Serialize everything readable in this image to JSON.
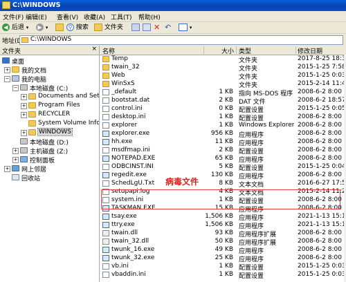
{
  "window": {
    "title": "C:\\WINDOWS"
  },
  "menu": [
    "文件(F)",
    "编辑(E)",
    "查看(V)",
    "收藏(A)",
    "工具(T)",
    "帮助(H)"
  ],
  "toolbar": {
    "back": "后退",
    "search": "搜索",
    "folders": "文件夹"
  },
  "address": {
    "label": "地址(D)",
    "value": "C:\\WINDOWS"
  },
  "left_pane": {
    "title": "文件夹",
    "close": "×",
    "tree": [
      {
        "label": "桌面",
        "icon": "desktop-icon"
      },
      {
        "label": "我的文档",
        "icon": "my-documents-icon",
        "pm": "+"
      },
      {
        "label": "我的电脑",
        "icon": "my-computer-icon",
        "pm": "−"
      },
      {
        "label": "本地磁盘 (C:)",
        "icon": "local-disk-icon",
        "pm": "−"
      },
      {
        "label": "Documents and Settings",
        "icon": "folder-icon",
        "pm": "+"
      },
      {
        "label": "Program Files",
        "icon": "folder-icon",
        "pm": "+"
      },
      {
        "label": "RECYCLER",
        "icon": "folder-icon",
        "pm": "+"
      },
      {
        "label": "System Volume Informat",
        "icon": "folder-icon",
        "pm": ""
      },
      {
        "label": "WINDOWS",
        "icon": "folder-icon",
        "pm": "+"
      },
      {
        "label": "本地磁盘 (D:)",
        "icon": "local-disk-icon",
        "pm": ""
      },
      {
        "label": "主机磁盘 (Z:)",
        "icon": "host-disk-icon",
        "pm": "+"
      },
      {
        "label": "控制面板",
        "icon": "control-panel-icon",
        "pm": "+"
      },
      {
        "label": "网上邻居",
        "icon": "network-icon",
        "pm": "+"
      },
      {
        "label": "回收站",
        "icon": "recycle-bin-icon",
        "pm": ""
      }
    ]
  },
  "columns": {
    "name": "名称",
    "size": "大小",
    "type": "类型",
    "modified": "修改日期"
  },
  "files": [
    {
      "name": "Temp",
      "size": "",
      "type": "文件夹",
      "date": "2017-8-25 18:30",
      "kind": "folder"
    },
    {
      "name": "twain_32",
      "size": "",
      "type": "文件夹",
      "date": "2015-1-25 7:58",
      "kind": "folder"
    },
    {
      "name": "Web",
      "size": "",
      "type": "文件夹",
      "date": "2015-1-25 0:03",
      "kind": "folder"
    },
    {
      "name": "WinSxS",
      "size": "",
      "type": "文件夹",
      "date": "2015-2-14 11:49",
      "kind": "folder"
    },
    {
      "name": "_default",
      "size": "1 KB",
      "type": "指向 MS-DOS 程序",
      "date": "2008-6-2 8:00",
      "kind": "file"
    },
    {
      "name": "bootstat.dat",
      "size": "2 KB",
      "type": "DAT 文件",
      "date": "2008-6-2 18:57",
      "kind": "file"
    },
    {
      "name": "control.ini",
      "size": "0 KB",
      "type": "配置设置",
      "date": "2015-1-25 0:05",
      "kind": "file"
    },
    {
      "name": "desktop.ini",
      "size": "1 KB",
      "type": "配置设置",
      "date": "2008-6-2 8:00",
      "kind": "file"
    },
    {
      "name": "explorer",
      "size": "1 KB",
      "type": "Windows Explorer C",
      "date": "2008-6-2 8:00",
      "kind": "file"
    },
    {
      "name": "explorer.exe",
      "size": "956 KB",
      "type": "应用程序",
      "date": "2008-6-2 8:00",
      "kind": "exe"
    },
    {
      "name": "hh.exe",
      "size": "11 KB",
      "type": "应用程序",
      "date": "2008-6-2 8:00",
      "kind": "exe"
    },
    {
      "name": "msdfmap.ini",
      "size": "2 KB",
      "type": "配置设置",
      "date": "2008-6-2 8:00",
      "kind": "file"
    },
    {
      "name": "NOTEPAD.EXE",
      "size": "65 KB",
      "type": "应用程序",
      "date": "2008-6-2 8:00",
      "kind": "exe"
    },
    {
      "name": "ODBCINST.INI",
      "size": "5 KB",
      "type": "配置设置",
      "date": "2015-1-25 0:04",
      "kind": "file"
    },
    {
      "name": "regedit.exe",
      "size": "130 KB",
      "type": "应用程序",
      "date": "2008-6-2 8:00",
      "kind": "exe"
    },
    {
      "name": "SchedLgU.Txt",
      "size": "8 KB",
      "type": "文本文档",
      "date": "2016-6-27 17:57",
      "kind": "file"
    },
    {
      "name": "setupapi.log",
      "size": "4 KB",
      "type": "文本文档",
      "date": "2015-2-14 11:20",
      "kind": "file"
    },
    {
      "name": "system.ini",
      "size": "1 KB",
      "type": "配置设置",
      "date": "2008-6-2 8:00",
      "kind": "file"
    },
    {
      "name": "TASKMAN.EXE",
      "size": "15 KB",
      "type": "应用程序",
      "date": "2008-6-2 8:00",
      "kind": "exe"
    },
    {
      "name": "tsay.exe",
      "size": "1,506 KB",
      "type": "应用程序",
      "date": "2021-1-13 15:18",
      "kind": "exe"
    },
    {
      "name": "ttry.exe",
      "size": "1,506 KB",
      "type": "应用程序",
      "date": "2021-1-13 15:18",
      "kind": "exe"
    },
    {
      "name": "twain.dll",
      "size": "93 KB",
      "type": "应用程序扩展",
      "date": "2008-6-2 8:00",
      "kind": "dll"
    },
    {
      "name": "twain_32.dll",
      "size": "50 KB",
      "type": "应用程序扩展",
      "date": "2008-6-2 8:00",
      "kind": "dll"
    },
    {
      "name": "twunk_16.exe",
      "size": "49 KB",
      "type": "应用程序",
      "date": "2008-6-2 8:00",
      "kind": "exe"
    },
    {
      "name": "twunk_32.exe",
      "size": "25 KB",
      "type": "应用程序",
      "date": "2008-6-2 8:00",
      "kind": "exe"
    },
    {
      "name": "vb.ini",
      "size": "1 KB",
      "type": "配置设置",
      "date": "2015-1-25 0:03",
      "kind": "file"
    },
    {
      "name": "vbaddin.ini",
      "size": "1 KB",
      "type": "配置设置",
      "date": "2015-1-25 0:03",
      "kind": "file"
    }
  ],
  "annotation": {
    "text": "病毒文件",
    "color": "#e02020"
  }
}
